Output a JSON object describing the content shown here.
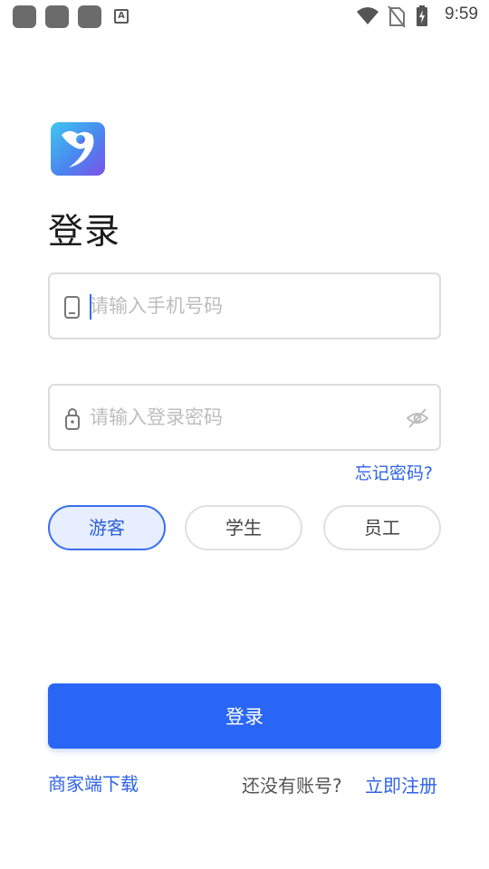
{
  "status_bar": {
    "time": "9:59",
    "notification_icon_letter": "A"
  },
  "login": {
    "title": "登录",
    "phone": {
      "value": "",
      "placeholder": "请输入手机号码"
    },
    "password": {
      "value": "",
      "placeholder": "请输入登录密码"
    },
    "forgot_password": "忘记密码?",
    "roles": [
      {
        "label": "游客",
        "selected": true
      },
      {
        "label": "学生",
        "selected": false
      },
      {
        "label": "员工",
        "selected": false
      }
    ],
    "submit_label": "登录",
    "merchant_download": "商家端下载",
    "no_account_text": "还没有账号?",
    "register_link": "立即注册"
  },
  "colors": {
    "primary": "#2a66f5",
    "link": "#2f63e6",
    "selected_bg": "#e6eeff"
  }
}
